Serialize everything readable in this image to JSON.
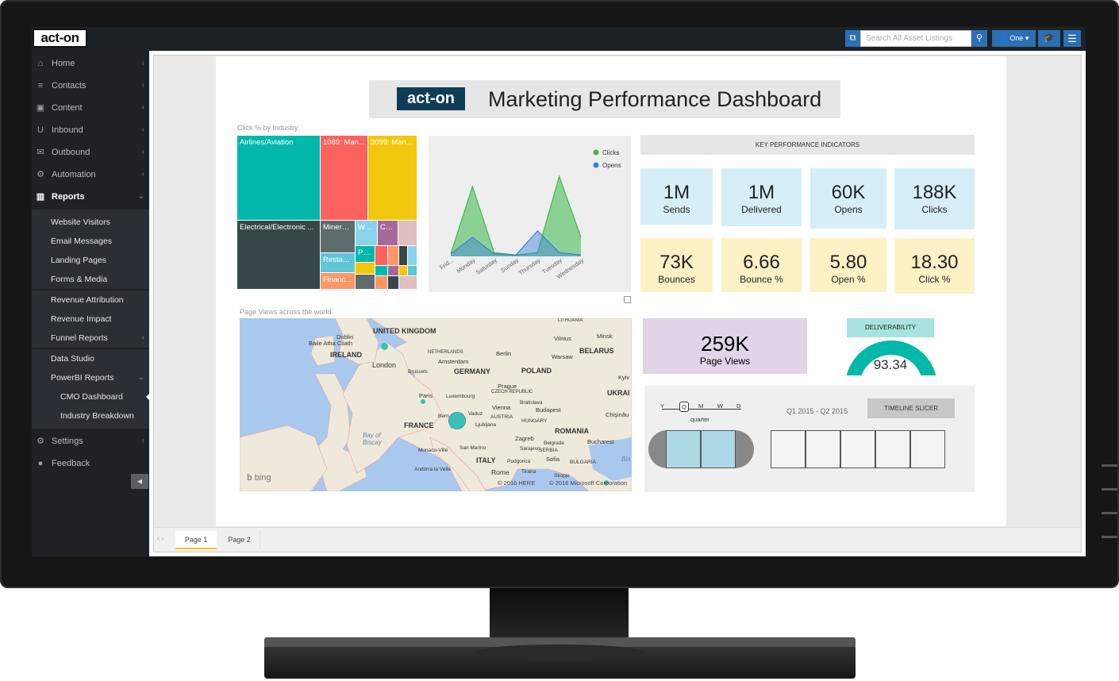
{
  "app": {
    "logo": "act-on",
    "search_placeholder": "Search All Asset Listings",
    "user_label": "One"
  },
  "sidebar": {
    "items": [
      {
        "label": "Home",
        "icon": "home-icon"
      },
      {
        "label": "Contacts",
        "icon": "database-icon"
      },
      {
        "label": "Content",
        "icon": "image-icon"
      },
      {
        "label": "Inbound",
        "icon": "magnet-icon"
      },
      {
        "label": "Outbound",
        "icon": "envelope-icon"
      },
      {
        "label": "Automation",
        "icon": "gears-icon"
      },
      {
        "label": "Reports",
        "icon": "bar-chart-icon"
      }
    ],
    "reports_sub": {
      "group1": [
        "Website Visitors",
        "Email Messages",
        "Landing Pages",
        "Forms & Media"
      ],
      "group2": [
        "Revenue Attribution",
        "Revenue Impact",
        "Funnel Reports"
      ],
      "group3": [
        "Data Studio",
        "PowerBI Reports"
      ],
      "powerbi": [
        "CMO Dashboard",
        "Industry Breakdown"
      ]
    },
    "bottom": [
      {
        "label": "Settings",
        "icon": "gear-icon"
      },
      {
        "label": "Feedback",
        "icon": "comment-icon"
      }
    ]
  },
  "dashboard": {
    "logo": "act-on",
    "title": "Marketing Performance Dashboard",
    "treemap_label": "Click % by Industry",
    "treemap": [
      {
        "label": "Airlines/Aviation",
        "color": "#01b8aa"
      },
      {
        "label": "1089: Man...",
        "color": "#fd625e"
      },
      {
        "label": "3099: Man...",
        "color": "#f2c80f"
      },
      {
        "label": "Electrical/Electronic ...",
        "color": "#374649"
      },
      {
        "label": "Mineral...",
        "color": "#5f6b6d"
      },
      {
        "label": "Wh...",
        "color": "#8ad4eb"
      },
      {
        "label": "Co...",
        "color": "#fe9666"
      },
      {
        "label": "Restaur...",
        "color": "#5fc6d8"
      },
      {
        "label": "Ph...",
        "color": "#01b8aa"
      },
      {
        "label": "Financ...",
        "color": "#fe9666"
      }
    ],
    "kpi_header": "KEY PERFORMANCE INDICATORS",
    "kpis_row1": [
      {
        "value": "1M",
        "label": "Sends"
      },
      {
        "value": "1M",
        "label": "Delivered"
      },
      {
        "value": "60K",
        "label": "Opens"
      },
      {
        "value": "188K",
        "label": "Clicks"
      }
    ],
    "kpis_row2": [
      {
        "value": "73K",
        "label": "Bounces"
      },
      {
        "value": "6.66",
        "label": "Bounce %"
      },
      {
        "value": "5.80",
        "label": "Open %"
      },
      {
        "value": "18.30",
        "label": "Click %"
      }
    ],
    "map_label": "Page Views across the world",
    "map_credit": "bing",
    "map_copyright1": "© 2016 HERE",
    "map_copyright2": "© 2016 Microsoft Corporation",
    "page_views": {
      "value": "259K",
      "label": "Page Views"
    },
    "deliverability": {
      "label": "DELIVERABILITY",
      "value": "93.34",
      "fraction": 0.9334
    },
    "slicer": {
      "levels": [
        "Y",
        "Q",
        "M",
        "W",
        "D"
      ],
      "level_label": "quarter",
      "range": "Q1 2015 - Q2 2015",
      "button": "TIMELINE SLICER"
    },
    "tabs": [
      "Page 1",
      "Page 2"
    ]
  },
  "map_labels": {
    "uk": "UNITED KINGDOM",
    "ireland": "IRELAND",
    "dublin": "Dublin",
    "baile": "Baile Atha Cliath",
    "london": "London",
    "netherlands": "NETHERLANDS",
    "amsterdam": "Amsterdam",
    "berlin": "Berlin",
    "germany": "GERMANY",
    "poland": "POLAND",
    "warsaw": "Warsaw",
    "vilnius": "Vilnius",
    "lithuania": "LITHUANIA",
    "minsk": "Minsk",
    "belarus": "BELARUS",
    "kyiv": "Kyiv",
    "ukraine": "UKRAI",
    "brussels": "Brussels",
    "paris": "Paris",
    "luxembourg": "Luxembourg",
    "france": "FRANCE",
    "czech": "CZECH REPUBLIC",
    "prague": "Prague",
    "vienna": "Vienna",
    "austria": "AUSTRIA",
    "bratislava": "Bratislava",
    "budapest": "Budapest",
    "hungary": "HUNGARY",
    "bern": "Bern",
    "vaduz": "Vaduz",
    "ljubljana": "Ljubljana",
    "zagreb": "Zagreb",
    "romania": "ROMANIA",
    "bucharest": "Bucharest",
    "chisinau": "Chişinău",
    "serbia": "SERBIA",
    "belgrade": "Belgrade",
    "sarajevo": "Sarajevo",
    "italy": "ITALY",
    "rome": "Rome",
    "sanmarino": "San Marino",
    "monaco": "Monaco-Ville",
    "andorra": "Andorra la Vella",
    "sofia": "Sofia",
    "bulgaria": "BULGARIA",
    "skopje": "Skopje",
    "tirana": "Tirana",
    "podgorica": "Podgorica",
    "bay": "Bay of Biscay",
    "bla": "Bla"
  },
  "chart_data": {
    "type": "area",
    "categories": [
      "Frid...",
      "Monday",
      "Saturday",
      "Sunday",
      "Thursday",
      "Tuesday",
      "Wednesday"
    ],
    "series": [
      {
        "name": "Clicks",
        "color": "#3cb94a",
        "values": [
          2,
          55,
          3,
          1,
          3,
          63,
          15
        ]
      },
      {
        "name": "Opens",
        "color": "#3a7fe0",
        "values": [
          2,
          15,
          2,
          1,
          20,
          3,
          1
        ]
      }
    ],
    "legend": "top-right"
  }
}
